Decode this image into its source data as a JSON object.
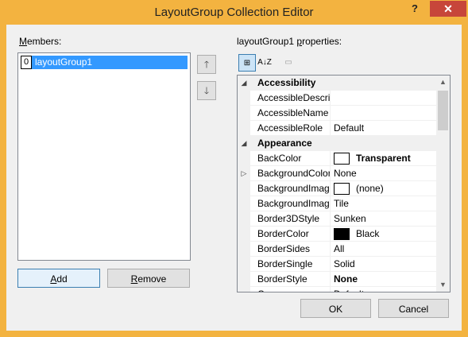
{
  "window": {
    "title": "LayoutGroup Collection Editor",
    "help": "?",
    "close": "✕"
  },
  "members": {
    "label_prefix": "M",
    "label_rest": "embers:",
    "items": [
      {
        "index": "0",
        "name": "layoutGroup1"
      }
    ]
  },
  "arrows": {
    "up": "🡑",
    "down": "🡓"
  },
  "buttons": {
    "add_u": "A",
    "add_rest": "dd",
    "remove_u": "R",
    "remove_rest": "emove",
    "ok": "OK",
    "cancel": "Cancel"
  },
  "props": {
    "label_pre": "layoutGroup1 ",
    "label_u": "p",
    "label_rest": "roperties:",
    "toolbar": {
      "categorized": "⊞",
      "alphabetical": "A↓Z",
      "pages": "▭"
    },
    "rows": [
      {
        "type": "cat",
        "name": "Accessibility"
      },
      {
        "type": "prop",
        "name": "AccessibleDescript",
        "value": ""
      },
      {
        "type": "prop",
        "name": "AccessibleName",
        "value": ""
      },
      {
        "type": "prop",
        "name": "AccessibleRole",
        "value": "Default"
      },
      {
        "type": "cat",
        "name": "Appearance"
      },
      {
        "type": "prop",
        "name": "BackColor",
        "value": "Transparent",
        "swatch": "#ffffff",
        "bold": true
      },
      {
        "type": "prop",
        "name": "BackgroundColor",
        "value": "None",
        "expandable": true
      },
      {
        "type": "prop",
        "name": "BackgroundImage",
        "value": "(none)",
        "swatch": "#ffffff"
      },
      {
        "type": "prop",
        "name": "BackgroundImageI",
        "value": "Tile"
      },
      {
        "type": "prop",
        "name": "Border3DStyle",
        "value": "Sunken"
      },
      {
        "type": "prop",
        "name": "BorderColor",
        "value": "Black",
        "swatch": "#000000"
      },
      {
        "type": "prop",
        "name": "BorderSides",
        "value": "All"
      },
      {
        "type": "prop",
        "name": "BorderSingle",
        "value": "Solid"
      },
      {
        "type": "prop",
        "name": "BorderStyle",
        "value": "None",
        "bold": true
      },
      {
        "type": "prop",
        "name": "Cursor",
        "value": "Default"
      }
    ]
  },
  "colors": {
    "titlebar": "#f3b340",
    "close": "#c7463a",
    "selection": "#3399ff"
  }
}
